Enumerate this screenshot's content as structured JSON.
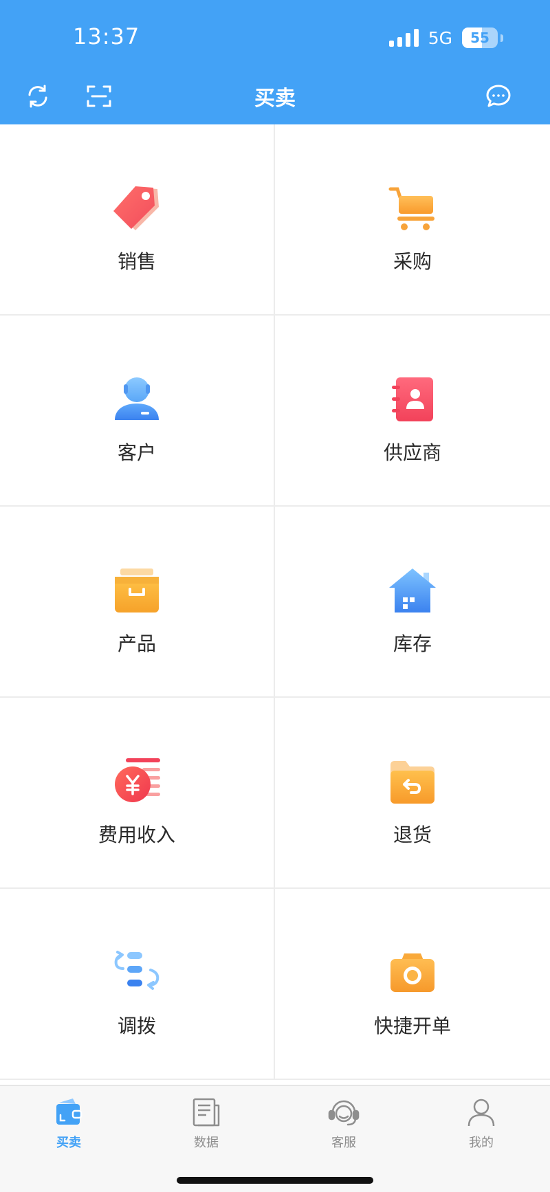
{
  "status_bar": {
    "time": "13:37",
    "network": "5G",
    "battery": "55"
  },
  "header": {
    "title": "买卖",
    "refresh_icon": "refresh-icon",
    "scan_icon": "scan-icon",
    "message_icon": "message-icon"
  },
  "menu": [
    {
      "label": "销售",
      "icon": "price-tag-icon"
    },
    {
      "label": "采购",
      "icon": "shopping-cart-icon"
    },
    {
      "label": "客户",
      "icon": "customer-icon"
    },
    {
      "label": "供应商",
      "icon": "contact-book-icon"
    },
    {
      "label": "产品",
      "icon": "product-box-icon"
    },
    {
      "label": "库存",
      "icon": "warehouse-icon"
    },
    {
      "label": "费用收入",
      "icon": "coin-icon"
    },
    {
      "label": "退货",
      "icon": "return-folder-icon"
    },
    {
      "label": "调拨",
      "icon": "transfer-icon"
    },
    {
      "label": "快捷开单",
      "icon": "camera-icon"
    }
  ],
  "tabs": [
    {
      "label": "买卖",
      "icon": "wallet-icon",
      "active": true
    },
    {
      "label": "数据",
      "icon": "report-icon",
      "active": false
    },
    {
      "label": "客服",
      "icon": "headset-icon",
      "active": false
    },
    {
      "label": "我的",
      "icon": "user-icon",
      "active": false
    }
  ],
  "colors": {
    "header": "#43a2f6",
    "active_tab": "#43a2f6",
    "inactive_tab": "#8e8e8e",
    "divider": "#ececec"
  }
}
